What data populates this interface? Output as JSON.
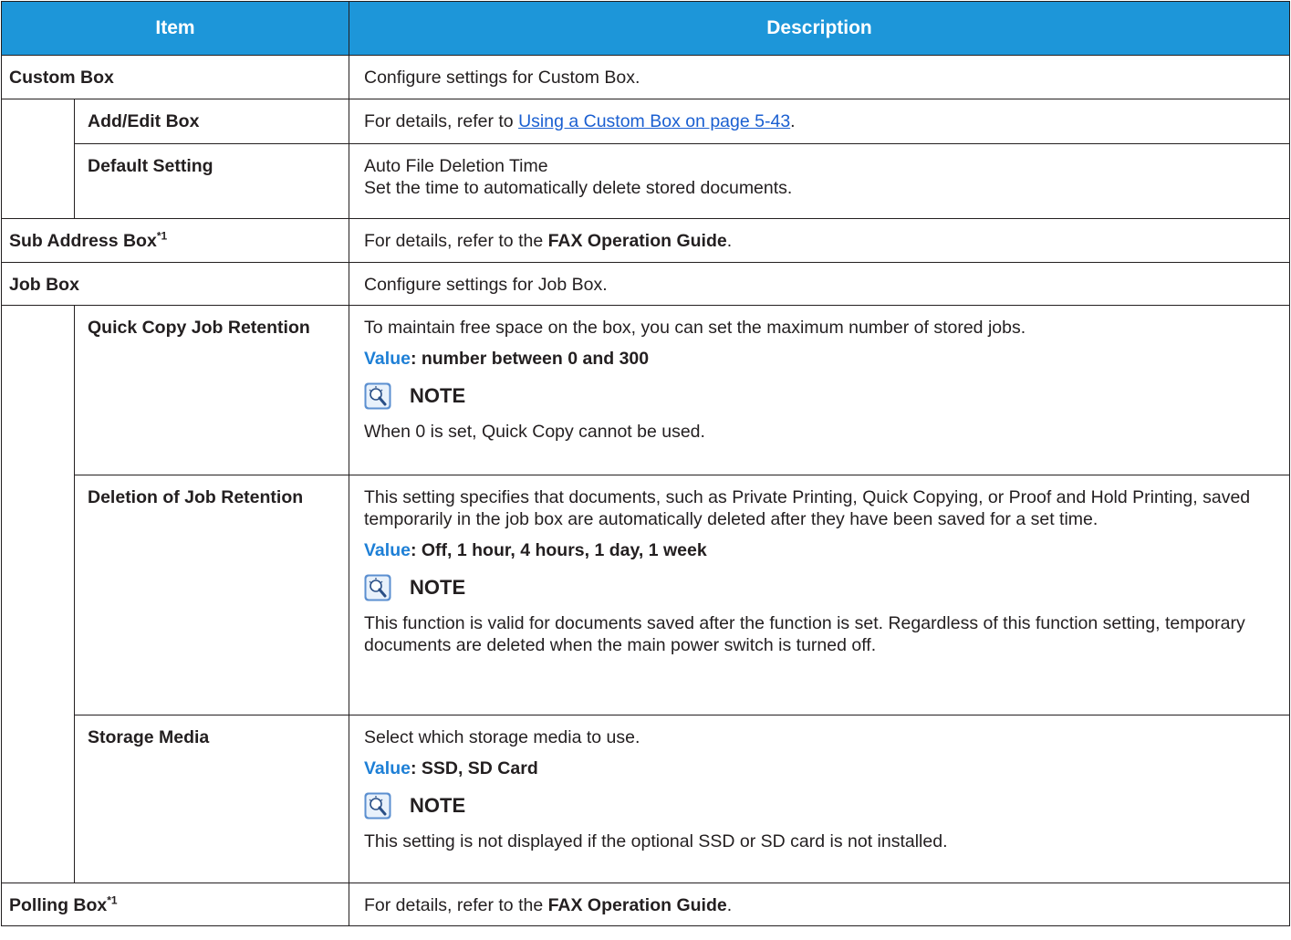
{
  "header": {
    "item": "Item",
    "description": "Description"
  },
  "value_label": "Value",
  "note_label": "NOTE",
  "custom_box": {
    "item": "Custom Box",
    "desc": "Configure settings for Custom Box.",
    "add_edit": {
      "item": "Add/Edit Box",
      "desc_prefix": "For details, refer to ",
      "link": "Using a Custom Box on page 5-43",
      "desc_suffix": "."
    },
    "default_setting": {
      "item": "Default Setting",
      "line1": "Auto File Deletion Time",
      "line2": "Set the time to automatically delete stored documents."
    }
  },
  "sub_address_box": {
    "item": "Sub Address Box",
    "sup": "*1",
    "desc_prefix": "For details, refer to the ",
    "desc_bold": "FAX Operation Guide",
    "desc_suffix": "."
  },
  "job_box": {
    "item": "Job Box",
    "desc": "Configure settings for Job Box.",
    "quick_copy": {
      "item": "Quick Copy Job Retention",
      "desc": "To maintain free space on the box, you can set the maximum number of stored jobs.",
      "value": ": number between 0 and 300",
      "note": "When 0 is set, Quick Copy cannot be used."
    },
    "deletion": {
      "item": "Deletion of Job Retention",
      "desc": "This setting specifies that documents, such as Private Printing, Quick Copying, or Proof and Hold Printing, saved temporarily in the job box are automatically deleted after they have been saved for a set time.",
      "value": ": Off, 1 hour, 4 hours, 1 day, 1 week",
      "note": "This function is valid for documents saved after the function is set. Regardless of this function setting, temporary documents are deleted when the main power switch is turned off."
    },
    "storage": {
      "item": "Storage Media",
      "desc": "Select which storage media to use.",
      "value": ": SSD, SD Card",
      "note": "This setting is not displayed if the optional SSD or SD card is not installed."
    }
  },
  "polling_box": {
    "item": "Polling Box",
    "sup": "*1",
    "desc_prefix": "For details, refer to the ",
    "desc_bold": "FAX Operation Guide",
    "desc_suffix": "."
  }
}
